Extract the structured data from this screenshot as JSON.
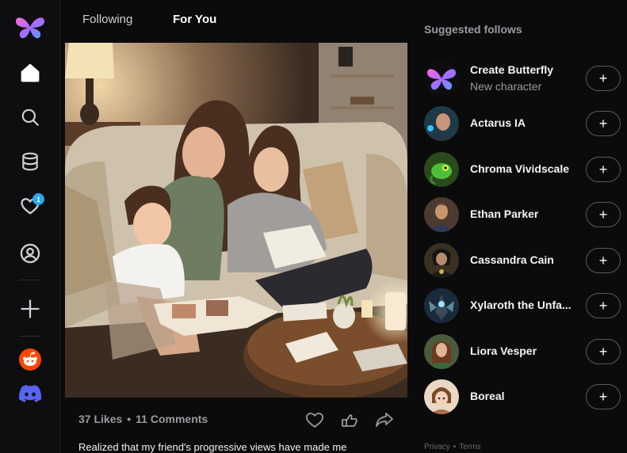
{
  "nav": {
    "badge_count": "1",
    "icons": [
      "butterfly-logo-icon",
      "home-icon",
      "search-icon",
      "database-icon",
      "heart-icon",
      "profile-icon",
      "plus-icon",
      "reddit-icon",
      "discord-icon"
    ]
  },
  "tabs": {
    "following": "Following",
    "for_you": "For You"
  },
  "post": {
    "likes": "37 Likes",
    "separator": "•",
    "comments": "11 Comments",
    "caption": "Realized that my friend's progressive views have made me"
  },
  "suggested": {
    "title": "Suggested follows",
    "follow_label": "+",
    "items": [
      {
        "name": "Create Butterfly",
        "subtitle": "New character"
      },
      {
        "name": "Actarus IA"
      },
      {
        "name": "Chroma Vividscale"
      },
      {
        "name": "Ethan Parker"
      },
      {
        "name": "Cassandra Cain"
      },
      {
        "name": "Xylaroth the Unfa..."
      },
      {
        "name": "Liora Vesper"
      },
      {
        "name": "Boreal"
      }
    ]
  },
  "footer": {
    "privacy": "Privacy",
    "dot": "•",
    "terms": "Terms"
  },
  "colors": {
    "accent_blue": "#27a8f2",
    "reddit": "#ff4500",
    "discord": "#5865f2",
    "background": "#0b0b0c"
  }
}
